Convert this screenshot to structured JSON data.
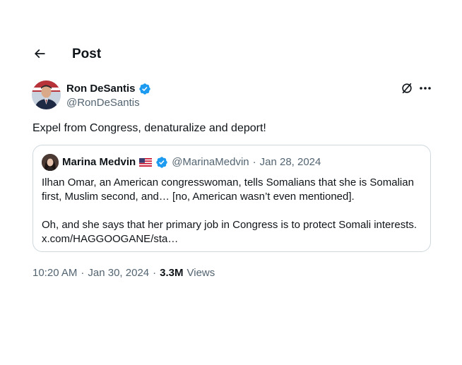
{
  "header": {
    "title": "Post",
    "back_icon": "arrow-left-icon"
  },
  "post": {
    "author": {
      "name": "Ron DeSantis",
      "handle": "@RonDeSantis",
      "verified_icon": "verified-badge-icon"
    },
    "actions": {
      "grok_icon": "grok-icon",
      "more_icon": "more-horizontal-icon"
    },
    "text": "Expel from Congress, denaturalize and deport!",
    "quote": {
      "author_name": "Marina Medvin",
      "flag": "us-flag-icon",
      "handle": "@MarinaMedvin",
      "separator": "·",
      "date": "Jan 28, 2024",
      "line1": "Ilhan Omar, an American congresswoman, tells Somalians that she is Somalian",
      "line2": "first, Muslim second, and… [no, American wasn’t even mentioned].",
      "line3": "Oh, and she says that her primary job in Congress is to protect Somali interests.",
      "link": "x.com/HAGGOOGANE/sta…"
    },
    "meta": {
      "time": "10:20 AM",
      "dot1": "·",
      "date": "Jan 30, 2024",
      "dot2": "·",
      "views_count": "3.3M",
      "views_label": "Views"
    }
  },
  "colors": {
    "text": "#0f1419",
    "secondary": "#536471",
    "border": "#cfd9de",
    "verified": "#1d9bf0"
  }
}
